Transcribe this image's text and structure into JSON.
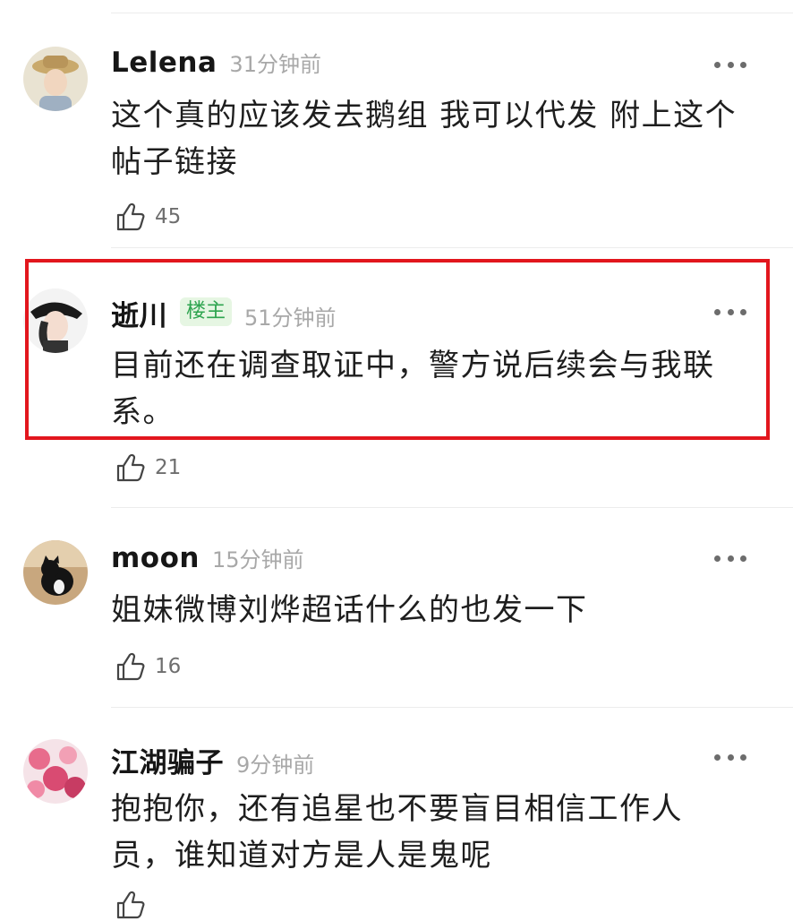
{
  "comments": [
    {
      "name": "Lelena",
      "badge": "",
      "time": "31分钟前",
      "text": "这个真的应该发去鹅组 我可以代发 附上这个帖子链接",
      "likes": "45",
      "avatar_icon": "avatar-straw-hat-painting"
    },
    {
      "name": "逝川",
      "badge": "楼主",
      "time": "51分钟前",
      "text": "目前还在调查取证中，警方说后续会与我联系。",
      "likes": "21",
      "avatar_icon": "avatar-black-hat-portrait"
    },
    {
      "name": "moon",
      "badge": "",
      "time": "15分钟前",
      "text": "姐妹微博刘烨超话什么的也发一下",
      "likes": "16",
      "avatar_icon": "avatar-black-cat"
    },
    {
      "name": "江湖骗子",
      "badge": "",
      "time": "9分钟前",
      "text": "抱抱你，还有追星也不要盲目相信工作人员，谁知道对方是人是鬼呢",
      "likes": "",
      "avatar_icon": "avatar-pink-flowers"
    }
  ],
  "colors": {
    "badge_bg": "#e6f6e3",
    "badge_text": "#2ea44f",
    "highlight": "#e2161d",
    "muted": "#a8a8a8"
  },
  "icons": {
    "more": "more-dots-icon",
    "like": "thumbs-up-icon"
  }
}
